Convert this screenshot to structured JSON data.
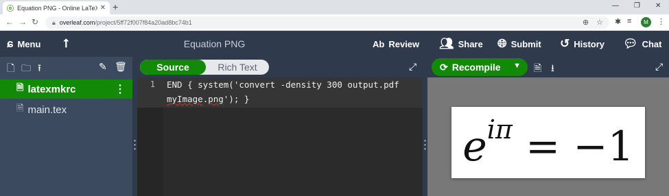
{
  "browser": {
    "tab_title": "Equation PNG - Online LaTeX Ed",
    "tab_favicon": "overleaf-leaf-icon",
    "url_host": "overleaf.com",
    "url_path": "/project/5ff72f007f84a20ad8bc74b1",
    "profile_initial": "M"
  },
  "toolbar": {
    "menu_label": "Menu",
    "project_title": "Equation PNG",
    "review_label": "Review",
    "share_label": "Share",
    "submit_label": "Submit",
    "history_label": "History",
    "chat_label": "Chat"
  },
  "files": [
    {
      "name": "latexmkrc",
      "active": true
    },
    {
      "name": "main.tex",
      "active": false
    }
  ],
  "editor": {
    "source_label": "Source",
    "rich_label": "Rich Text",
    "line_number": "1",
    "code_line1": "END { system('convert -density 300 output.pdf",
    "code_line2_pre": "",
    "code_line2_sq1": "myImage",
    "code_line2_mid": ".",
    "code_line2_sq2": "png",
    "code_line2_post": "'); }"
  },
  "pdf": {
    "recompile_label": "Recompile",
    "equation_base": "e",
    "equation_exp": "iπ",
    "equation_rest": " = −1"
  },
  "colors": {
    "toolbar": "#2f3a4c",
    "accent_green": "#138a07",
    "file_panel": "#3b4a5e"
  }
}
